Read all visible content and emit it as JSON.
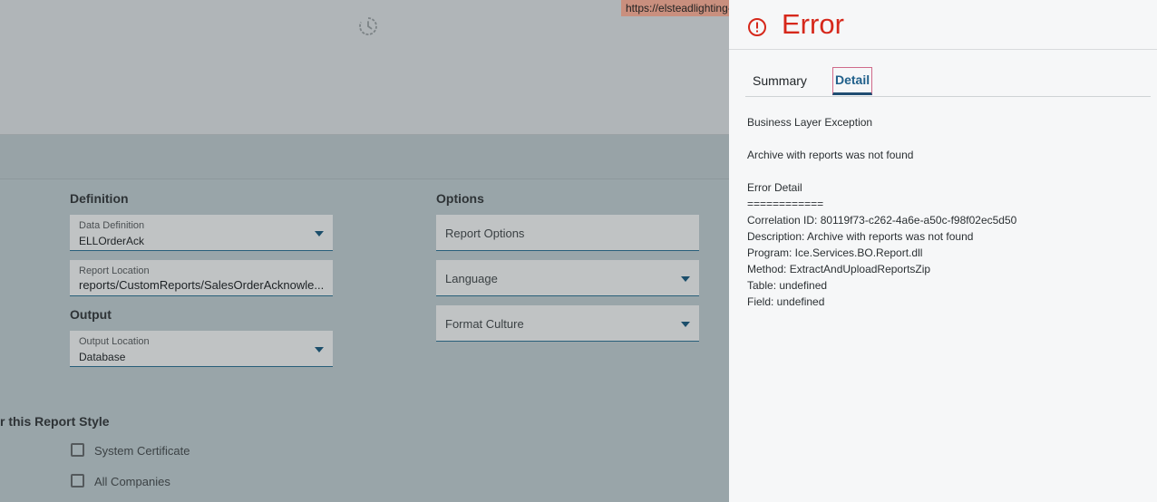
{
  "tooltip": {
    "url": "https://elsteadlighting-"
  },
  "definition": {
    "heading": "Definition",
    "data_definition": {
      "label": "Data Definition",
      "value": "ELLOrderAck"
    },
    "report_location": {
      "label": "Report Location",
      "value": "reports/CustomReports/SalesOrderAcknowle..."
    }
  },
  "output": {
    "heading": "Output",
    "output_location": {
      "label": "Output Location",
      "value": "Database"
    }
  },
  "options": {
    "heading": "Options",
    "report_options": "Report Options",
    "language": "Language",
    "format_culture": "Format Culture"
  },
  "report_style": {
    "heading": "r this Report Style",
    "system_certificate": "System Certificate",
    "all_companies": "All Companies"
  },
  "error_panel": {
    "title": "Error",
    "tabs": [
      "Summary",
      "Detail"
    ],
    "active_tab": "Detail",
    "lines": [
      "Business Layer Exception",
      "",
      "Archive with reports was not found",
      "",
      "Error Detail",
      "============",
      "Correlation ID: 80119f73-c262-4a6e-a50c-f98f02ec5d50",
      "Description: Archive with reports was not found",
      "Program: Ice.Services.BO.Report.dll",
      "Method: ExtractAndUploadReportsZip",
      "Table: undefined",
      "Field: undefined"
    ]
  },
  "colors": {
    "error_red": "#d6281b",
    "accent_blue": "#1f5f8a"
  }
}
